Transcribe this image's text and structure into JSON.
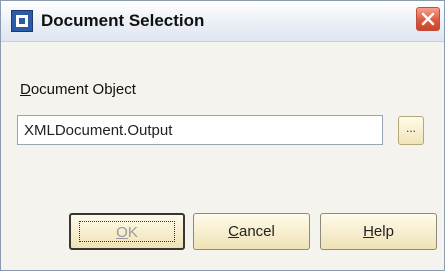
{
  "window": {
    "title": "Document Selection"
  },
  "form": {
    "label_mnemonic": "D",
    "label_rest": "ocument Object",
    "input_value": "XMLDocument.Output",
    "browse_label": "..."
  },
  "buttons": {
    "ok_mnemonic": "O",
    "ok_rest": "K",
    "cancel_mnemonic": "C",
    "cancel_rest": "ancel",
    "help_mnemonic": "H",
    "help_rest": "elp"
  },
  "icons": {
    "app": "app-window-icon",
    "close": "close-icon"
  },
  "colors": {
    "close_button": "#de5a3e",
    "button_face": "#f1e4b8"
  }
}
